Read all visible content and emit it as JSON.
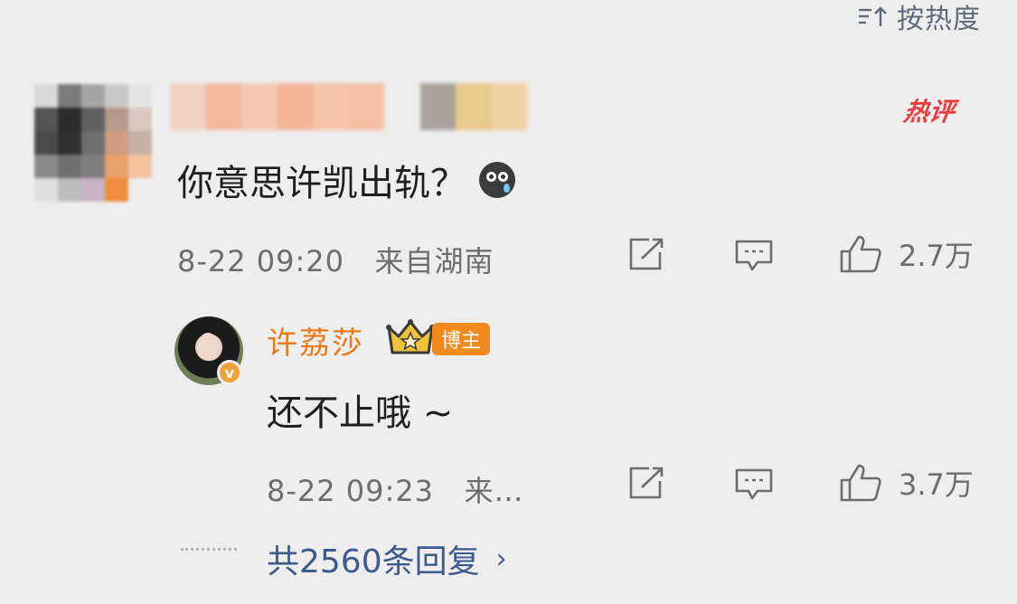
{
  "sort": {
    "label": "按热度",
    "icon": "sort-icon"
  },
  "comment": {
    "badge": "热评",
    "text": "你意思许凯出轨？",
    "emoji": "crying-emoji",
    "time": "8-22 09:20",
    "location": "来自湖南",
    "likes": "2.7万"
  },
  "reply": {
    "author": "许荔莎",
    "badge": "博主",
    "verify_mark": "v",
    "text": "还不止哦 ~",
    "time": "8-22 09:23",
    "location": "来…",
    "likes": "3.7万"
  },
  "more": {
    "label": "共2560条回复",
    "chevron": "›"
  },
  "colors": {
    "background": "#eeeeee",
    "accent_orange": "#e97a19",
    "link_blue": "#3d5b8c",
    "hot_red": "#ea3d3d"
  }
}
